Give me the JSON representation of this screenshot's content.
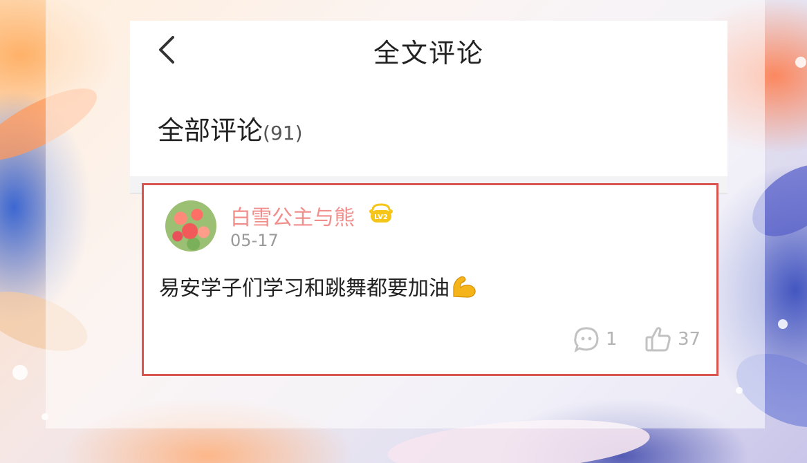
{
  "header": {
    "title": "全文评论",
    "back_icon": "chevron-left-icon"
  },
  "comments_section": {
    "title": "全部评论",
    "count": "(91)"
  },
  "comment": {
    "username": "白雪公主与熊",
    "level": "LV2",
    "date": "05-17",
    "text": "易安学子们学习和跳舞都要加油",
    "emoji": "flexed-biceps-icon",
    "reply_count": "1",
    "like_count": "37"
  },
  "colors": {
    "highlight_border": "#d9534f",
    "username": "#f08e8c",
    "badge": "#f5c518",
    "meta": "#b3b3b3"
  }
}
